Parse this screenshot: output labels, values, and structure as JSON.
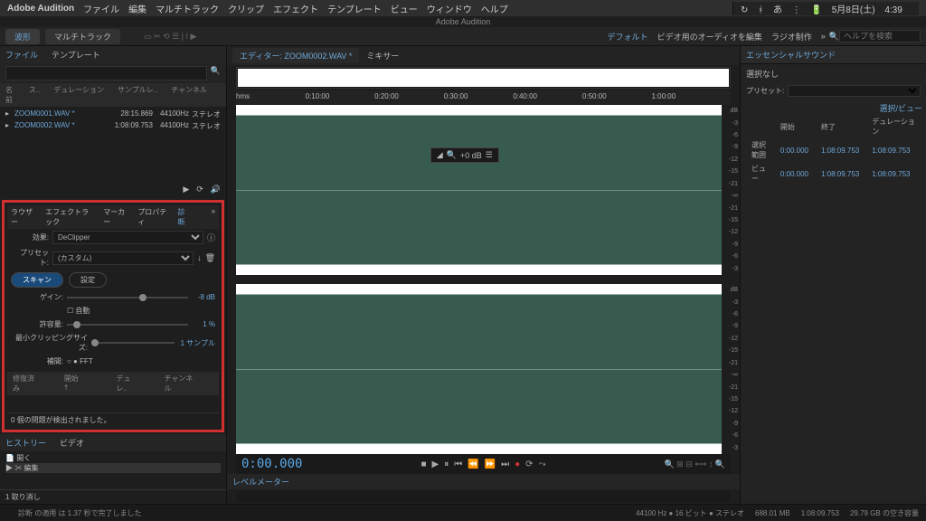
{
  "mac": {
    "app": "Adobe Audition",
    "menus": [
      "ファイル",
      "編集",
      "マルチトラック",
      "クリップ",
      "エフェクト",
      "テンプレート",
      "ビュー",
      "ウィンドウ",
      "ヘルプ"
    ],
    "date": "5月8日(土)",
    "time": "4:39"
  },
  "window_title": "Adobe Audition",
  "top_tabs": {
    "waveform": "波形",
    "multitrack": "マルチトラック"
  },
  "right_top": {
    "default": "デフォルト",
    "edit_audio": "ビデオ用のオーディオを編集",
    "radio": "ラジオ制作",
    "search_placeholder": "ヘルプを検索"
  },
  "files": {
    "tab_file": "ファイル",
    "tab_template": "テンプレート",
    "col_name": "名前",
    "col_status": "ス..",
    "col_dur": "デュレーション",
    "col_sr": "サンプルレ..",
    "col_ch": "チャンネル",
    "rows": [
      {
        "name": "ZOOM0001.WAV *",
        "dur": "28:15.869",
        "sr": "44100Hz",
        "ch": "ステレオ"
      },
      {
        "name": "ZOOM0002.WAV *",
        "dur": "1:08:09.753",
        "sr": "44100Hz",
        "ch": "ステレオ"
      }
    ]
  },
  "diag": {
    "tabs": [
      "ラウザー",
      "エフェクトラック",
      "マーカー",
      "プロパティ",
      "診断"
    ],
    "effect_label": "効果:",
    "effect_value": "DeClipper",
    "preset_label": "プリセット:",
    "preset_value": "(カスタム)",
    "scan": "スキャン",
    "settings": "設定",
    "gain": "ゲイン:",
    "gain_val": "-8 dB",
    "auto": "自動",
    "tol": "許容量:",
    "tol_val": "1 %",
    "minclip": "最小クリッピングサイズ:",
    "minclip_val": "1 サンプル",
    "interp": "補間:",
    "fft": "FFT",
    "repair_col": "修復済み",
    "start": "開始 †",
    "dur": "デュレ..",
    "ch": "チャンネル",
    "status": "0 個の問題が検出されました。"
  },
  "history": {
    "tab1": "ヒストリー",
    "tab2": "ビデオ",
    "open": "開く",
    "edit": "編集",
    "undo": "1 取り消し"
  },
  "editor": {
    "tab_editor": "エディター:",
    "filename": "ZOOM0002.WAV *",
    "mixer": "ミキサー",
    "ruler": [
      "hms",
      "0:10:00",
      "0:20:00",
      "0:30:00",
      "0:40:00",
      "0:50:00",
      "1:00:00"
    ],
    "hud": "+0 dB",
    "time": "0:00.000",
    "level": "レベルメーター"
  },
  "ess": {
    "title": "エッセンシャルサウンド",
    "no_sel": "選択なし",
    "preset": "プリセット:"
  },
  "sel": {
    "title": "選択/ビュー",
    "h_start": "開始",
    "h_end": "終了",
    "h_dur": "デュレーション",
    "sel_lbl": "選択範囲",
    "view_lbl": "ビュー",
    "sel_start": "0:00.000",
    "sel_end": "1:08:09.753",
    "sel_dur": "1:08:09.753",
    "view_start": "0:00.000",
    "view_end": "1:08:09.753",
    "view_dur": "1:08:09.753"
  },
  "bottom_status": {
    "msg": "診断 の適用 は 1.37 秒で完了しました",
    "sr": "44100 Hz ● 16 ビット ● ステレオ",
    "size": "688.01 MB",
    "dur": "1:08:09.753",
    "disk": "29.79 GB の空き容量"
  }
}
